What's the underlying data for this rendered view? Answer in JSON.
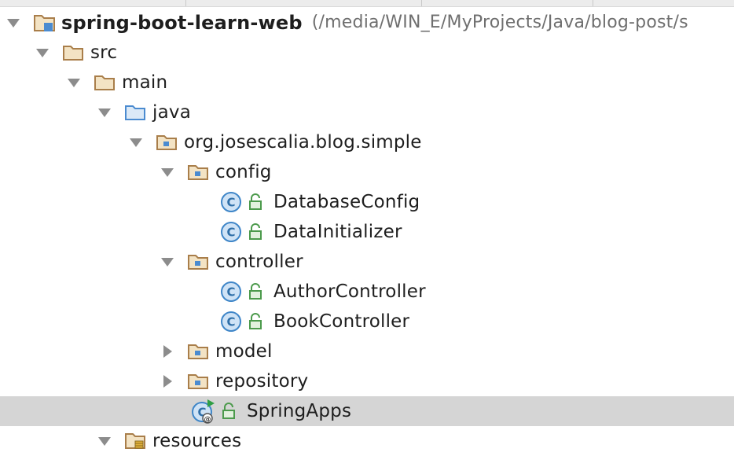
{
  "project": {
    "name": "spring-boot-learn-web",
    "path": "(/media/WIN_E/MyProjects/Java/blog-post/s"
  },
  "tree": {
    "src": "src",
    "main": "main",
    "java": "java",
    "package": "org.josescalia.blog.simple",
    "config": "config",
    "database_config": "DatabaseConfig",
    "data_initializer": "DataInitializer",
    "controller": "controller",
    "author_controller": "AuthorController",
    "book_controller": "BookController",
    "model": "model",
    "repository": "repository",
    "spring_apps": "SpringApps",
    "resources": "resources"
  },
  "icons": {
    "folder": "folder-icon",
    "source_folder": "source-folder-icon",
    "package": "package-icon",
    "class": "class-icon",
    "runnable_class": "runnable-class-icon",
    "resources_folder": "resources-folder-icon",
    "lock": "lock-icon"
  },
  "colors": {
    "selection": "#d5d5d5",
    "class_blue": "#3f86c8",
    "folder_brown": "#a97e4a",
    "source_blue": "#4b8bd0",
    "lock_green": "#4c9a4c"
  }
}
